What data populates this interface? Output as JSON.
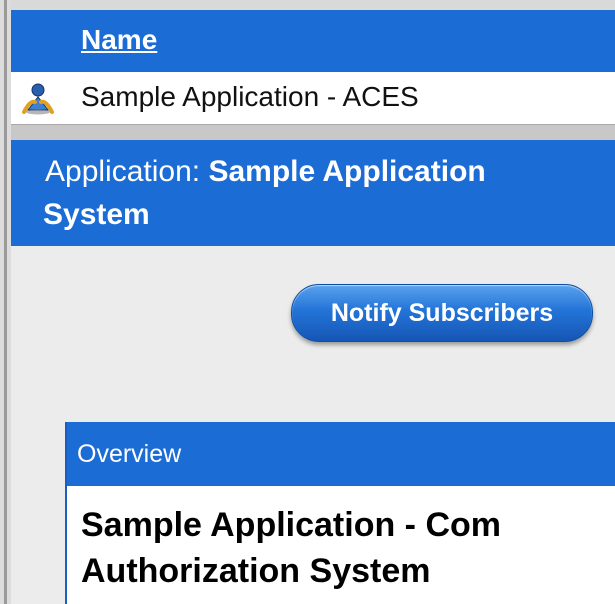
{
  "table": {
    "column_header": "Name",
    "row": {
      "icon": "user-icon",
      "label": "Sample Application - ACES"
    }
  },
  "application_header": {
    "prefix": "Application:",
    "name_line1": "Sample Application",
    "name_line2": "System"
  },
  "actions": {
    "notify_label": "Notify Subscribers"
  },
  "overview": {
    "header": "Overview",
    "title_line1": "Sample Application - Com",
    "title_line2": "Authorization System"
  },
  "colors": {
    "header_blue": "#1c6cd6",
    "content_gray": "#ececec"
  }
}
